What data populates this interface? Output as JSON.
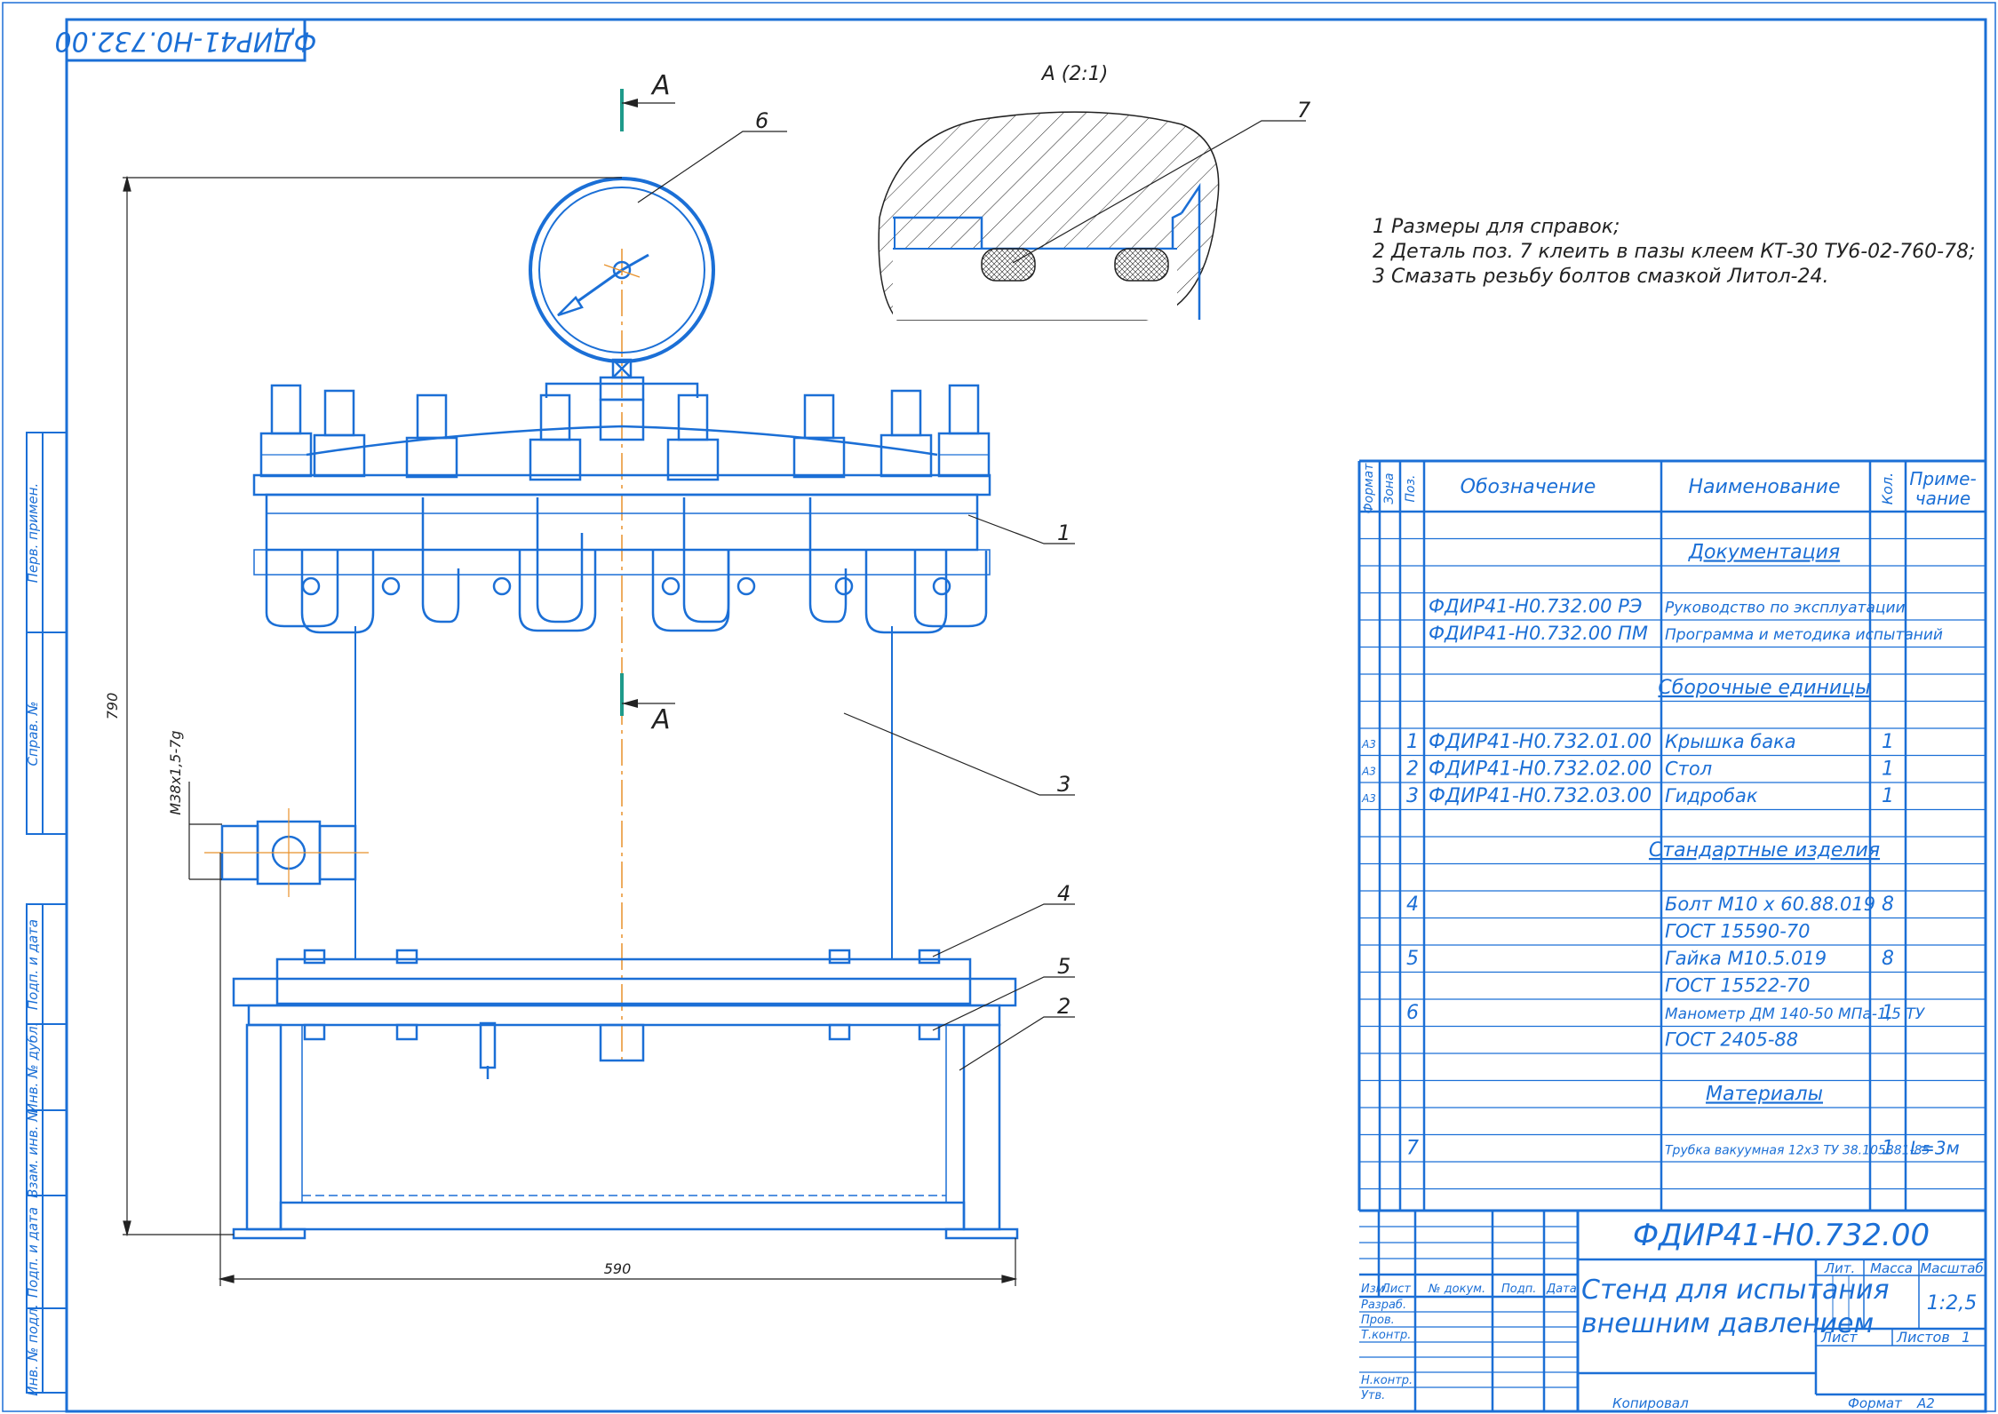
{
  "colors": {
    "line": "#1b6fd6",
    "accent": "#e8912a",
    "dim": "#222222",
    "frame": "#1b6fd6"
  },
  "stamp": "ФДИР41-Н0.732.00",
  "section": {
    "title": "А (2:1)",
    "part_pos": "7",
    "mark": "А"
  },
  "notes": [
    "1  Размеры для справок;",
    "2  Деталь поз. 7 клеить в пазы клеем  КТ-30 ТУ6-02-760-78;",
    "3  Смазать резьбу болтов смазкой Литол-24."
  ],
  "drawing": {
    "dim_height": "790",
    "dim_width": "590",
    "dim_thread": "М38х1,5-7g",
    "callouts": [
      "6",
      "1",
      "3",
      "4",
      "5",
      "2"
    ]
  },
  "left_strip": [
    "Перв. примен.",
    "Справ. №",
    "Подп. и дата",
    "Инв. № дубл.",
    "Взам. инв. №",
    "Подп. и дата",
    "Инв. № подл."
  ],
  "spec": {
    "headers": {
      "format": "Формат",
      "zone": "Зона",
      "pos": "Поз.",
      "designation": "Обозначение",
      "name": "Наименование",
      "qty": "Кол.",
      "note": "Приме-\nчание"
    },
    "rows": [
      {
        "fmt": "",
        "pos": "",
        "des": "",
        "name": "",
        "qty": "",
        "note": "",
        "heading": false
      },
      {
        "fmt": "",
        "pos": "",
        "des": "",
        "name": "Документация",
        "qty": "",
        "note": "",
        "heading": true
      },
      {
        "fmt": "",
        "pos": "",
        "des": "",
        "name": "",
        "qty": "",
        "note": "",
        "heading": false
      },
      {
        "fmt": "",
        "pos": "",
        "des": "ФДИР41-Н0.732.00 РЭ",
        "name": "Руководство по эксплуатации",
        "qty": "",
        "note": "",
        "heading": false,
        "small": true
      },
      {
        "fmt": "",
        "pos": "",
        "des": "ФДИР41-Н0.732.00 ПМ",
        "name": "Программа и методика испытаний",
        "qty": "",
        "note": "",
        "heading": false,
        "small": true
      },
      {
        "fmt": "",
        "pos": "",
        "des": "",
        "name": "",
        "qty": "",
        "note": "",
        "heading": false
      },
      {
        "fmt": "",
        "pos": "",
        "des": "",
        "name": "Сборочные единицы",
        "qty": "",
        "note": "",
        "heading": true
      },
      {
        "fmt": "",
        "pos": "",
        "des": "",
        "name": "",
        "qty": "",
        "note": "",
        "heading": false
      },
      {
        "fmt": "А3",
        "pos": "1",
        "des": "ФДИР41-Н0.732.01.00",
        "name": "Крышка бака",
        "qty": "1",
        "note": "",
        "heading": false
      },
      {
        "fmt": "А3",
        "pos": "2",
        "des": "ФДИР41-Н0.732.02.00",
        "name": "Стол",
        "qty": "1",
        "note": "",
        "heading": false
      },
      {
        "fmt": "А3",
        "pos": "3",
        "des": "ФДИР41-Н0.732.03.00",
        "name": "Гидробак",
        "qty": "1",
        "note": "",
        "heading": false
      },
      {
        "fmt": "",
        "pos": "",
        "des": "",
        "name": "",
        "qty": "",
        "note": "",
        "heading": false
      },
      {
        "fmt": "",
        "pos": "",
        "des": "",
        "name": "Стандартные изделия",
        "qty": "",
        "note": "",
        "heading": true
      },
      {
        "fmt": "",
        "pos": "",
        "des": "",
        "name": "",
        "qty": "",
        "note": "",
        "heading": false
      },
      {
        "fmt": "",
        "pos": "4",
        "des": "",
        "name": "Болт М10 х 60.88.019",
        "qty": "8",
        "note": "",
        "heading": false
      },
      {
        "fmt": "",
        "pos": "",
        "des": "",
        "name": "ГОСТ 15590-70",
        "qty": "",
        "note": "",
        "heading": false
      },
      {
        "fmt": "",
        "pos": "5",
        "des": "",
        "name": "Гайка М10.5.019",
        "qty": "8",
        "note": "",
        "heading": false
      },
      {
        "fmt": "",
        "pos": "",
        "des": "",
        "name": "ГОСТ 15522-70",
        "qty": "",
        "note": "",
        "heading": false
      },
      {
        "fmt": "",
        "pos": "6",
        "des": "",
        "name": "Манометр ДМ 140-50 МПа-1,5 ТУ",
        "qty": "1",
        "note": "",
        "heading": false,
        "small": true
      },
      {
        "fmt": "",
        "pos": "",
        "des": "",
        "name": "ГОСТ 2405-88",
        "qty": "",
        "note": "",
        "heading": false
      },
      {
        "fmt": "",
        "pos": "",
        "des": "",
        "name": "",
        "qty": "",
        "note": "",
        "heading": false
      },
      {
        "fmt": "",
        "pos": "",
        "des": "",
        "name": "Материалы",
        "qty": "",
        "note": "",
        "heading": true
      },
      {
        "fmt": "",
        "pos": "",
        "des": "",
        "name": "",
        "qty": "",
        "note": "",
        "heading": false
      },
      {
        "fmt": "",
        "pos": "7",
        "des": "",
        "name": "Трубка вакуумная 12х3 ТУ 38.105881-85",
        "qty": "1",
        "note": "L=3м",
        "heading": false,
        "small": true
      },
      {
        "fmt": "",
        "pos": "",
        "des": "",
        "name": "",
        "qty": "",
        "note": "",
        "heading": false
      },
      {
        "fmt": "",
        "pos": "",
        "des": "",
        "name": "",
        "qty": "",
        "note": "",
        "heading": false
      }
    ]
  },
  "title_block": {
    "designation": "ФДИР41-Н0.732.00",
    "title_line1": "Стенд для испытания",
    "title_line2": "внешним давлением",
    "cols": {
      "izm": "Изм.",
      "list": "Лист",
      "doc": "№ докум.",
      "podp": "Подп.",
      "date": "Дата"
    },
    "roles": [
      "Разраб.",
      "Пров.",
      "Т.контр.",
      "Н.контр.",
      "Утв."
    ],
    "lit": "Лит.",
    "mass": "Масса",
    "scale_label": "Масштаб",
    "scale": "1:2,5",
    "sheet": "Лист",
    "sheets": "Листов",
    "sheets_count": "1",
    "copied": "Копировал",
    "format": "Формат",
    "format_value": "А2"
  }
}
